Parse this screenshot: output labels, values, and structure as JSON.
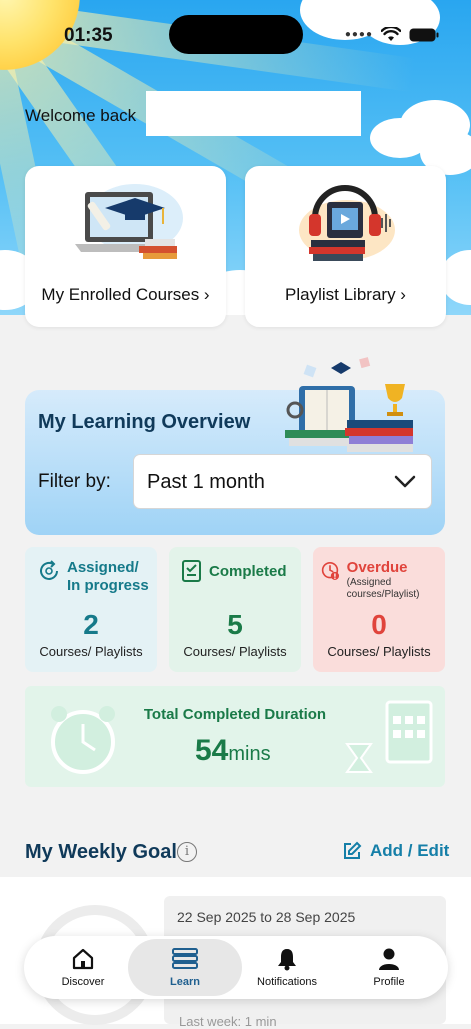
{
  "status_bar": {
    "time": "01:35"
  },
  "header": {
    "welcome": "Welcome back"
  },
  "quick_cards": [
    {
      "label": "My Enrolled Courses ›"
    },
    {
      "label": "Playlist Library ›"
    }
  ],
  "overview": {
    "title": "My Learning Overview",
    "filter_label": "Filter by:",
    "filter_value": "Past 1 month"
  },
  "stats": {
    "assigned": {
      "title_line1": "Assigned/",
      "title_line2": "In progress",
      "count": "2",
      "unit": "Courses/ Playlists",
      "color": "#167a8a"
    },
    "completed": {
      "title": "Completed",
      "count": "5",
      "unit": "Courses/ Playlists",
      "color": "#1a7a48"
    },
    "overdue": {
      "title": "Overdue",
      "subtitle": "(Assigned courses/Playlist)",
      "count": "0",
      "unit": "Courses/ Playlists",
      "color": "#e0443c"
    }
  },
  "duration": {
    "title": "Total Completed Duration",
    "value": "54",
    "unit": "mins"
  },
  "weekly_goal": {
    "title": "My Weekly Goal",
    "info_icon": "i",
    "action": "Add / Edit",
    "range": "22 Sep 2025 to 28 Sep 2025",
    "last_week": "Last week: 1 min"
  },
  "nav": [
    {
      "label": "Discover",
      "icon": "home-icon"
    },
    {
      "label": "Learn",
      "icon": "books-icon",
      "active": true
    },
    {
      "label": "Notifications",
      "icon": "bell-icon"
    },
    {
      "label": "Profile",
      "icon": "person-icon"
    }
  ]
}
